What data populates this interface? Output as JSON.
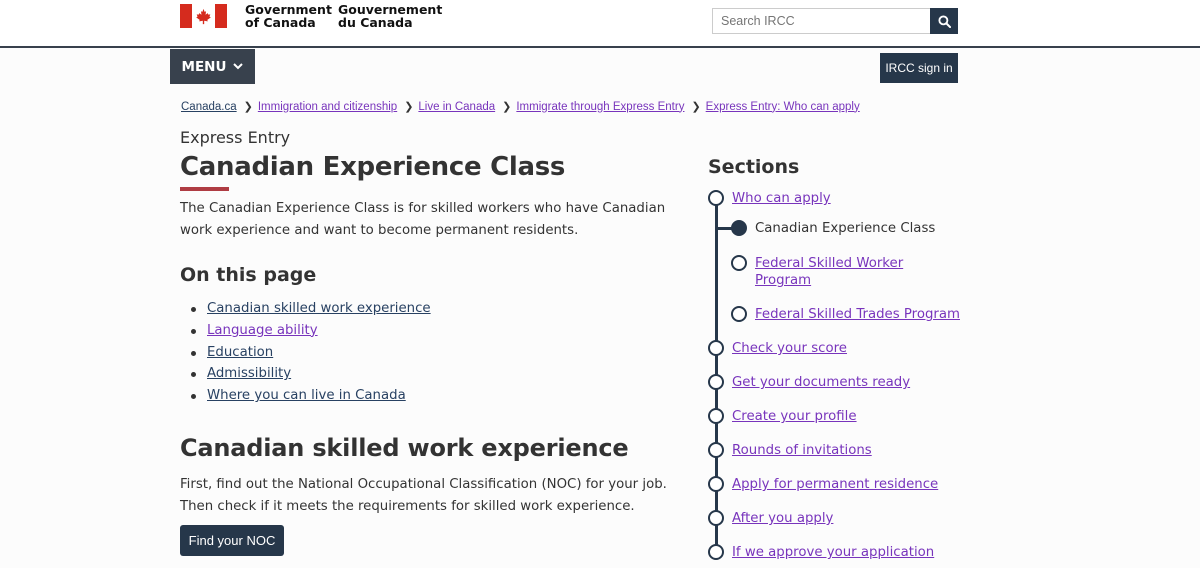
{
  "header": {
    "signature_en": [
      "Government",
      "of Canada"
    ],
    "signature_fr": [
      "Gouvernement",
      "du Canada"
    ],
    "search_placeholder": "Search IRCC",
    "menu_label": "MENU",
    "signin_label": "IRCC sign in"
  },
  "breadcrumb": [
    "Canada.ca",
    "Immigration and citizenship",
    "Live in Canada",
    "Immigrate through Express Entry",
    "Express Entry: Who can apply"
  ],
  "page": {
    "kicker": "Express Entry",
    "title": "Canadian Experience Class",
    "intro": "The Canadian Experience Class is for skilled workers who have Canadian work experience and want to become permanent residents.",
    "on_this_page_heading": "On this page",
    "on_this_page": [
      "Canadian skilled work experience",
      "Language ability",
      "Education",
      "Admissibility",
      "Where you can live in Canada"
    ],
    "section_heading": "Canadian skilled work experience",
    "section_text": "First, find out the National Occupational Classification (NOC) for your job. Then check if it meets the requirements for skilled work experience.",
    "noc_button": "Find your NOC"
  },
  "sections": {
    "heading": "Sections",
    "steps": [
      "Who can apply",
      "Check your score",
      "Get your documents ready",
      "Create your profile",
      "Rounds of invitations",
      "Apply for permanent residence",
      "After you apply",
      "If we approve your application"
    ],
    "substeps": [
      "Canadian Experience Class",
      "Federal Skilled Worker Program",
      "Federal Skilled Trades Program"
    ]
  },
  "colors": {
    "navy": "#26374a",
    "link": "#284162",
    "visited": "#7834bc",
    "accent_red": "#af3c43",
    "flag_red": "#d52b1e"
  }
}
